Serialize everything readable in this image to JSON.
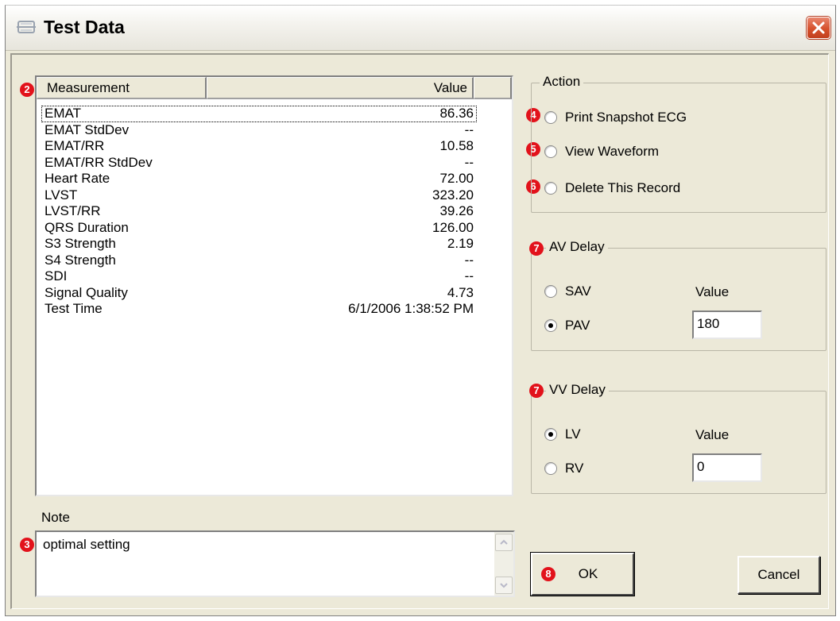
{
  "window": {
    "title": "Test Data"
  },
  "callouts": {
    "list": "2",
    "note": "3",
    "print": "4",
    "view": "5",
    "delete": "6",
    "av": "7",
    "vv": "7",
    "ok": "8"
  },
  "measurements": {
    "columns": [
      "Measurement",
      "Value"
    ],
    "rows": [
      {
        "name": "EMAT",
        "value": "86.36"
      },
      {
        "name": "EMAT StdDev",
        "value": "--"
      },
      {
        "name": "EMAT/RR",
        "value": "10.58"
      },
      {
        "name": "EMAT/RR StdDev",
        "value": "--"
      },
      {
        "name": "Heart Rate",
        "value": "72.00"
      },
      {
        "name": "LVST",
        "value": "323.20"
      },
      {
        "name": "LVST/RR",
        "value": "39.26"
      },
      {
        "name": "QRS Duration",
        "value": "126.00"
      },
      {
        "name": "S3 Strength",
        "value": "2.19"
      },
      {
        "name": "S4 Strength",
        "value": "--"
      },
      {
        "name": "SDI",
        "value": "--"
      },
      {
        "name": "Signal Quality",
        "value": "4.73"
      },
      {
        "name": "Test Time",
        "value": "6/1/2006 1:38:52 PM"
      }
    ]
  },
  "note": {
    "label": "Note",
    "value": "optimal setting"
  },
  "action": {
    "label": "Action",
    "options": [
      "Print Snapshot ECG",
      "View Waveform",
      "Delete This Record"
    ]
  },
  "av_delay": {
    "label": "AV Delay",
    "options": [
      "SAV",
      "PAV"
    ],
    "selected": "PAV",
    "value_label": "Value",
    "value": "180"
  },
  "vv_delay": {
    "label": "VV Delay",
    "options": [
      "LV",
      "RV"
    ],
    "selected": "LV",
    "value_label": "Value",
    "value": "0"
  },
  "buttons": {
    "ok": "OK",
    "cancel": "Cancel"
  }
}
